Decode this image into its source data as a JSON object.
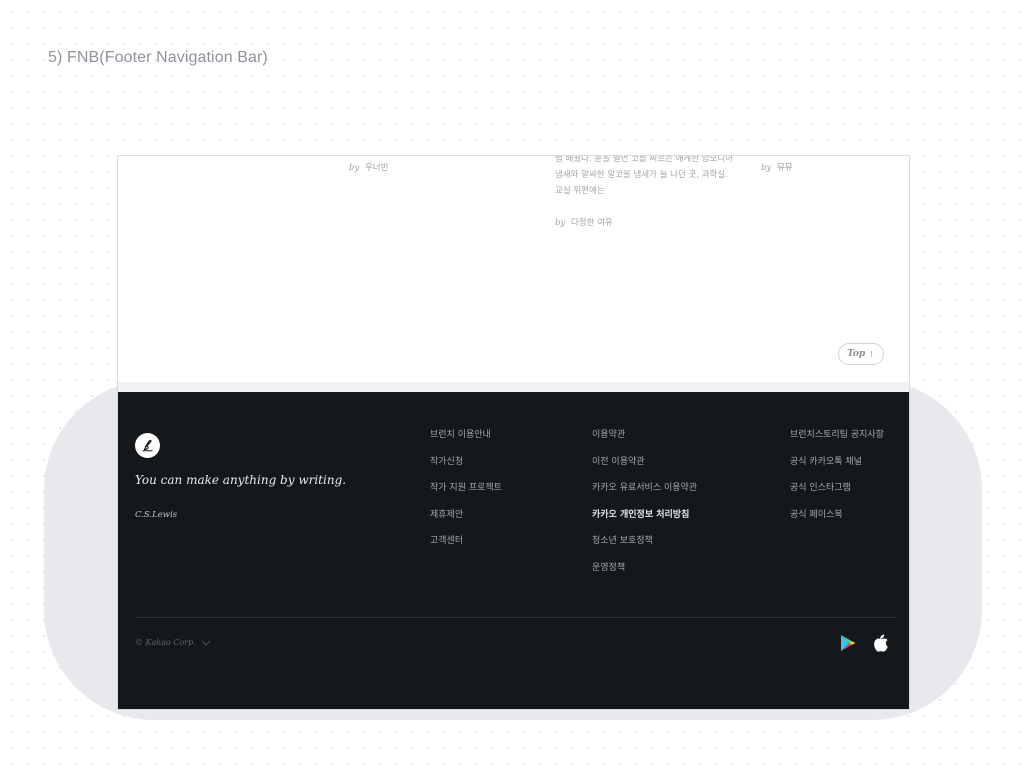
{
  "page": {
    "section_heading": "5) FNB(Footer Navigation Bar)"
  },
  "content": {
    "byline_left": {
      "prefix": "by",
      "author": "우너빈"
    },
    "excerpt": {
      "lines": [
        "렘 배웠다. 분을 열면 코를 찌르는 애게한 암모니아",
        "냄새와 알싸한 알코올 냄새가 늘 나던 곳, 과학실.",
        "교실 뒤편에는"
      ],
      "byline": {
        "prefix": "by",
        "author": "다정한 여유"
      }
    },
    "byline_right": {
      "prefix": "by",
      "author": "뮤뮤"
    },
    "top_button": {
      "label": "Top",
      "arrow": "↑"
    }
  },
  "footer": {
    "tagline": "You can make anything by writing.",
    "tagline_author": "C.S.Lewis",
    "col1": [
      "브런치 이용안내",
      "작가신청",
      "작가 지원 프로젝트",
      "제휴제안",
      "고객센터"
    ],
    "col2": [
      "이용약관",
      "이전 이용약관",
      "카카오 유료서비스 이용약관",
      "카카오 개인정보 처리방침",
      "청소년 보호정책",
      "운영정책"
    ],
    "col3": [
      "브런치스토리팀 공지사항",
      "공식 카카오톡 채널",
      "공식 인스타그램",
      "공식 페이스북"
    ],
    "copyright": "© Kakao Corp.",
    "icons": {
      "copyright_toggle": "chevron-down-icon",
      "store1": "google-play-icon",
      "store2": "apple-icon"
    }
  },
  "colors": {
    "footer_bg": "#15181b",
    "halo": "#e7e9ed",
    "heading": "#8e939b"
  }
}
